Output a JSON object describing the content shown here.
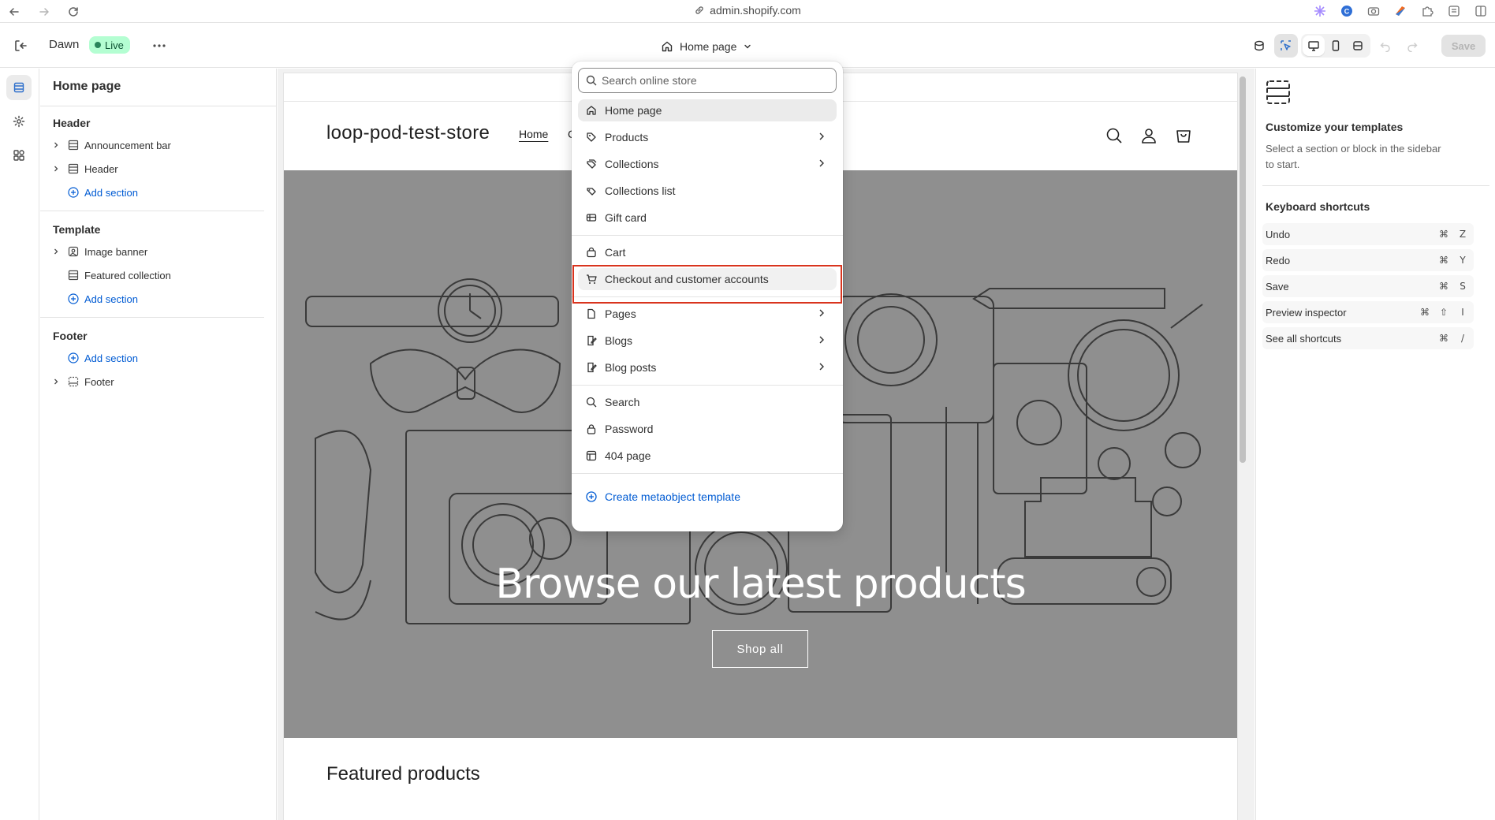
{
  "browser": {
    "url": "admin.shopify.com"
  },
  "topbar": {
    "theme_name": "Dawn",
    "live_label": "Live",
    "page_selector_label": "Home page",
    "save_label": "Save"
  },
  "sidebar": {
    "title": "Home page",
    "header_group": {
      "title": "Header",
      "items": [
        {
          "label": "Announcement bar"
        },
        {
          "label": "Header"
        }
      ],
      "add_label": "Add section"
    },
    "template_group": {
      "title": "Template",
      "items": [
        {
          "label": "Image banner"
        },
        {
          "label": "Featured collection"
        }
      ],
      "add_label": "Add section"
    },
    "footer_group": {
      "title": "Footer",
      "add_label": "Add section",
      "items": [
        {
          "label": "Footer"
        }
      ]
    }
  },
  "preview": {
    "store_name": "loop-pod-test-store",
    "nav_home": "Home",
    "nav_partial": "C",
    "banner_heading": "Browse our latest products",
    "banner_button": "Shop all",
    "featured_heading": "Featured products"
  },
  "right_panel": {
    "title": "Customize your templates",
    "description": "Select a section or block in the sidebar to start.",
    "shortcuts_title": "Keyboard shortcuts",
    "shortcuts": [
      {
        "label": "Undo",
        "keys": [
          "⌘",
          "Z"
        ]
      },
      {
        "label": "Redo",
        "keys": [
          "⌘",
          "Y"
        ]
      },
      {
        "label": "Save",
        "keys": [
          "⌘",
          "S"
        ]
      },
      {
        "label": "Preview inspector",
        "keys": [
          "⌘",
          "⇧",
          "I"
        ]
      },
      {
        "label": "See all shortcuts",
        "keys": [
          "⌘",
          "/"
        ]
      }
    ]
  },
  "dropdown": {
    "search_placeholder": "Search online store",
    "items": [
      {
        "label": "Home page",
        "icon": "home-icon"
      },
      {
        "label": "Products",
        "icon": "tag-icon"
      },
      {
        "label": "Collections",
        "icon": "collection-icon"
      },
      {
        "label": "Collections list",
        "icon": "collection-list-icon"
      },
      {
        "label": "Gift card",
        "icon": "gift-card-icon"
      },
      {
        "label": "Cart",
        "icon": "cart-bag-icon"
      },
      {
        "label": "Checkout and customer accounts",
        "icon": "cart-icon"
      },
      {
        "label": "Pages",
        "icon": "page-icon"
      },
      {
        "label": "Blogs",
        "icon": "blog-icon"
      },
      {
        "label": "Blog posts",
        "icon": "blog-post-icon"
      },
      {
        "label": "Search",
        "icon": "search-icon"
      },
      {
        "label": "Password",
        "icon": "lock-icon"
      },
      {
        "label": "404 page",
        "icon": "404-icon"
      },
      {
        "label": "Create metaobject template",
        "icon": "plus-circle-icon"
      }
    ]
  },
  "colors": {
    "accent_link": "#005bd3",
    "live_badge_bg": "#b4fed2",
    "highlight_border": "#d9341e",
    "banner_bg": "#8f8f8f"
  }
}
